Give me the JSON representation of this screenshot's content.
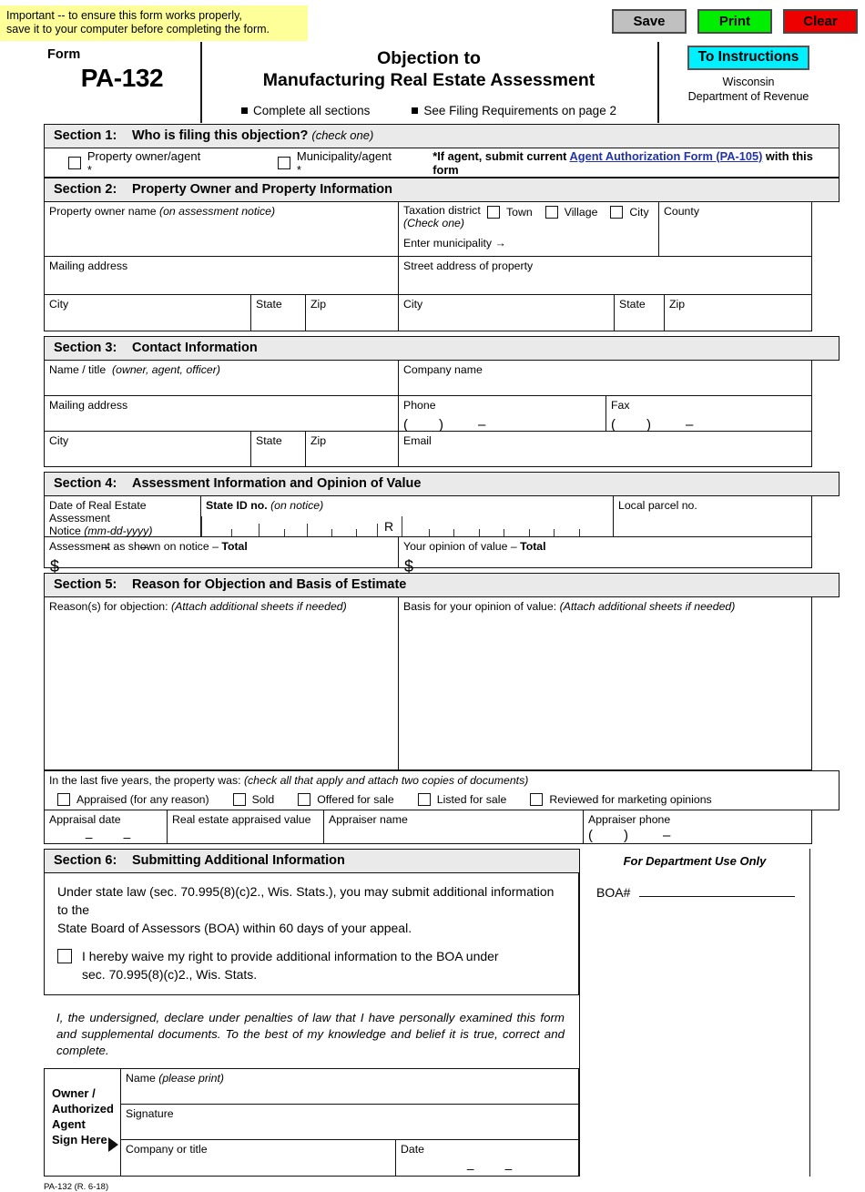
{
  "notice": {
    "line1": "Important -- to ensure this form works properly,",
    "line2": "save it to your computer before completing the form."
  },
  "toolbar": {
    "save_label": "Save",
    "print_label": "Print",
    "clear_label": "Clear",
    "save_color": "#c0c0c0",
    "print_color": "#00ee00",
    "clear_color": "#ef0000"
  },
  "header": {
    "form_label": "Form",
    "form_number": "PA-132",
    "title_line1": "Objection to",
    "title_line2": "Manufacturing Real Estate Assessment",
    "bullet1": "Complete all sections",
    "bullet2": "See Filing Requirements on page 2",
    "instructions_button": "To Instructions",
    "instructions_color": "#00f0ff",
    "agency_line1": "Wisconsin",
    "agency_line2": "Department of Revenue"
  },
  "section1": {
    "number": "Section 1:",
    "title": "Who is filing this objection?",
    "title_note": "(check one)",
    "option1": "Property owner/agent *",
    "option2": "Municipality/agent *",
    "note_prefix": "*If agent, submit current ",
    "note_link": "Agent Authorization Form (PA-105)",
    "note_suffix": " with this form"
  },
  "section2": {
    "number": "Section 2:",
    "title": "Property Owner and Property Information",
    "owner_name": "Property owner name",
    "owner_name_note": "(on assessment notice)",
    "taxation_district": "Taxation district",
    "taxation_district_note": "(Check one)",
    "district_options": [
      "Town",
      "Village",
      "City"
    ],
    "enter_municipality": "Enter municipality →",
    "county": "County",
    "mailing_address": "Mailing address",
    "street_address": "Street address of property",
    "city": "City",
    "state": "State",
    "zip": "Zip",
    "city2": "City",
    "state2": "State",
    "zip2": "Zip"
  },
  "section3": {
    "number": "Section 3:",
    "title": "Contact Information",
    "name_title": "Name / title",
    "name_title_note": "(owner, agent, officer)",
    "company_name": "Company name",
    "mailing_address": "Mailing address",
    "phone": "Phone",
    "fax": "Fax",
    "city": "City",
    "state": "State",
    "zip": "Zip",
    "email": "Email"
  },
  "section4": {
    "number": "Section 4:",
    "title": "Assessment Information and Opinion of Value",
    "date_label_line1": "Date of Real Estate Assessment",
    "date_label_line2": "Notice",
    "date_format": "(mm-dd-yyyy)",
    "state_id": "State ID no.",
    "state_id_note": "(on notice)",
    "state_id_marker": "R",
    "local_parcel": "Local parcel no.",
    "assessment_shown": "Assessment as shown on notice – ",
    "assessment_shown_bold": "Total",
    "opinion_value": "Your opinion of value – ",
    "opinion_value_bold": "Total",
    "currency": "$"
  },
  "section5": {
    "number": "Section 5:",
    "title": "Reason for Objection and Basis of Estimate",
    "reasons": "Reason(s) for objection:",
    "reasons_note": "(Attach additional sheets if needed)",
    "basis": "Basis for your opinion of value:",
    "basis_note": "(Attach additional sheets if needed)",
    "lastfive_label": "In the last five years, the property was:",
    "lastfive_note": "(check all that apply and attach two copies of documents)",
    "lastfive_options": [
      "Appraised (for any reason)",
      "Sold",
      "Offered for sale",
      "Listed for sale",
      "Reviewed for marketing opinions"
    ],
    "appraisal_date": "Appraisal date",
    "appraised_value": "Real estate appraised value",
    "appraiser_name": "Appraiser name",
    "appraiser_phone": "Appraiser phone"
  },
  "section6": {
    "number": "Section 6:",
    "title": "Submitting Additional Information",
    "body_line1": "Under state law (sec. 70.995(8)(c)2., Wis. Stats.), you may submit additional information to the",
    "body_line2": "State Board of Assessors (BOA) within 60 days of your appeal.",
    "waive_line1": "I hereby waive my right to provide additional information to the BOA under",
    "waive_line2": "sec. 70.995(8)(c)2., Wis. Stats.",
    "dept_use": "For Department Use Only",
    "boa_label": "BOA#"
  },
  "declaration": {
    "line1": "I, the undersigned, declare under penalties of law that I have personally examined this form and",
    "line2": "supplemental documents.  To the best of my knowledge and belief it is true, correct and complete."
  },
  "signature": {
    "sign_here_line1": "Owner /",
    "sign_here_line2": "Authorized",
    "sign_here_line3": "Agent",
    "sign_here_line4": "Sign Here",
    "name": "Name",
    "name_note": "(please print)",
    "signature": "Signature",
    "company_title": "Company or title",
    "date": "Date"
  },
  "footer": {
    "revision": "PA-132 (R. 6-18)"
  }
}
